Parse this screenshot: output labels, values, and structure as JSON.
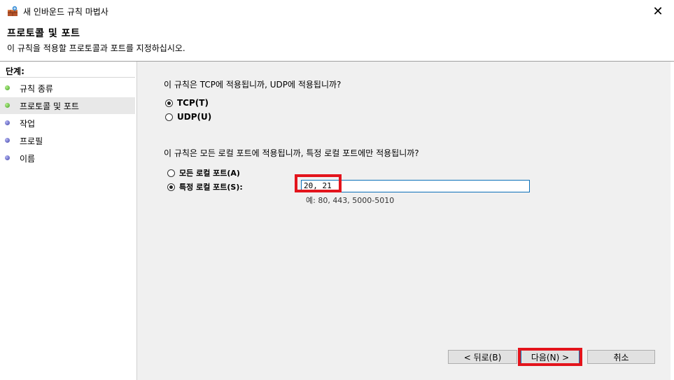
{
  "window": {
    "title": "새 인바운드 규칙 마법사",
    "close_glyph": "✕",
    "app_icon": "firewall-icon"
  },
  "header": {
    "title": "프로토콜 및 포트",
    "subtitle": "이 규칙을 적용할 프로토콜과 포트를 지정하십시오."
  },
  "sidebar": {
    "title": "단계:",
    "items": [
      {
        "label": "규칙 종류",
        "status": "complete",
        "color": "#3f9e20"
      },
      {
        "label": "프로토콜 및 포트",
        "status": "current",
        "color": "#3f9e20"
      },
      {
        "label": "작업",
        "status": "pending",
        "color": "#3d3fa8"
      },
      {
        "label": "프로필",
        "status": "pending",
        "color": "#3d3fa8"
      },
      {
        "label": "이름",
        "status": "pending",
        "color": "#3d3fa8"
      }
    ]
  },
  "main": {
    "protocol_question": "이 규칙은 TCP에 적용됩니까, UDP에 적용됩니까?",
    "protocol_options": [
      {
        "label": "TCP(T)",
        "selected": true
      },
      {
        "label": "UDP(U)",
        "selected": false
      }
    ],
    "port_question": "이 규칙은 모든 로컬 포트에 적용됩니까, 특정 로컬 포트에만 적용됩니까?",
    "port_options": [
      {
        "label": "모든 로컬 포트(A)",
        "selected": false
      },
      {
        "label": "특정 로컬 포트(S):",
        "selected": true
      }
    ],
    "port_value": "20, 21",
    "port_example": "예: 80, 443, 5000-5010"
  },
  "buttons": {
    "back": "< 뒤로(B)",
    "next": "다음(N) >",
    "cancel": "취소"
  },
  "highlight_color": "#e3141c"
}
